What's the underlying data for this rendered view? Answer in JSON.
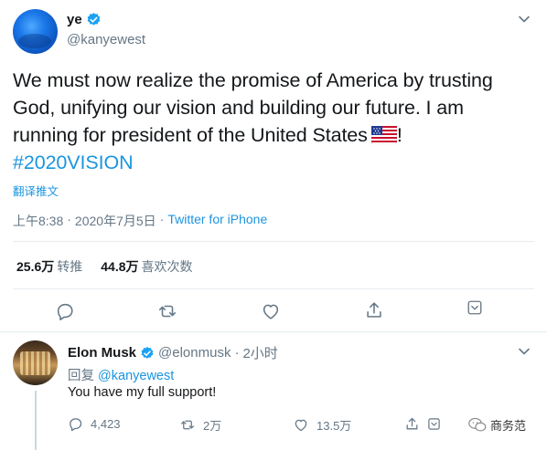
{
  "main_tweet": {
    "author_name": "ye",
    "author_handle": "@kanyewest",
    "text_line1": "We must now realize the promise of America by trusting",
    "text_line2": "God, unifying our vision and building our future. I am",
    "text_line3": "running for president of the United States",
    "text_line3_end": "!",
    "hashtag": "#2020VISION",
    "translate_label": "翻译推文",
    "time": "上午8:38",
    "separator": "·",
    "date": "2020年7月5日",
    "source": "Twitter for iPhone",
    "retweets_count": "25.6万",
    "retweets_label": "转推",
    "likes_count": "44.8万",
    "likes_label": "喜欢次数"
  },
  "reply_tweet": {
    "author_name": "Elon Musk",
    "author_handle": "@elonmusk",
    "separator": "·",
    "time_ago": "2小时",
    "reply_prefix": "回复",
    "reply_to": "@kanyewest",
    "text": "You have my full support!",
    "replies_count": "4,423",
    "retweets_count": "2万",
    "likes_count": "13.5万"
  },
  "watermark": {
    "label": "商务范"
  },
  "icons": [
    "verified-badge-icon",
    "chevron-down-icon",
    "us-flag-emoji",
    "reply-icon",
    "retweet-icon",
    "like-icon",
    "share-icon",
    "wechat-icon"
  ],
  "colors": {
    "link_blue": "#1b95e0",
    "text_primary": "#14171a",
    "text_secondary": "#657786",
    "divider": "#e6ecf0"
  }
}
